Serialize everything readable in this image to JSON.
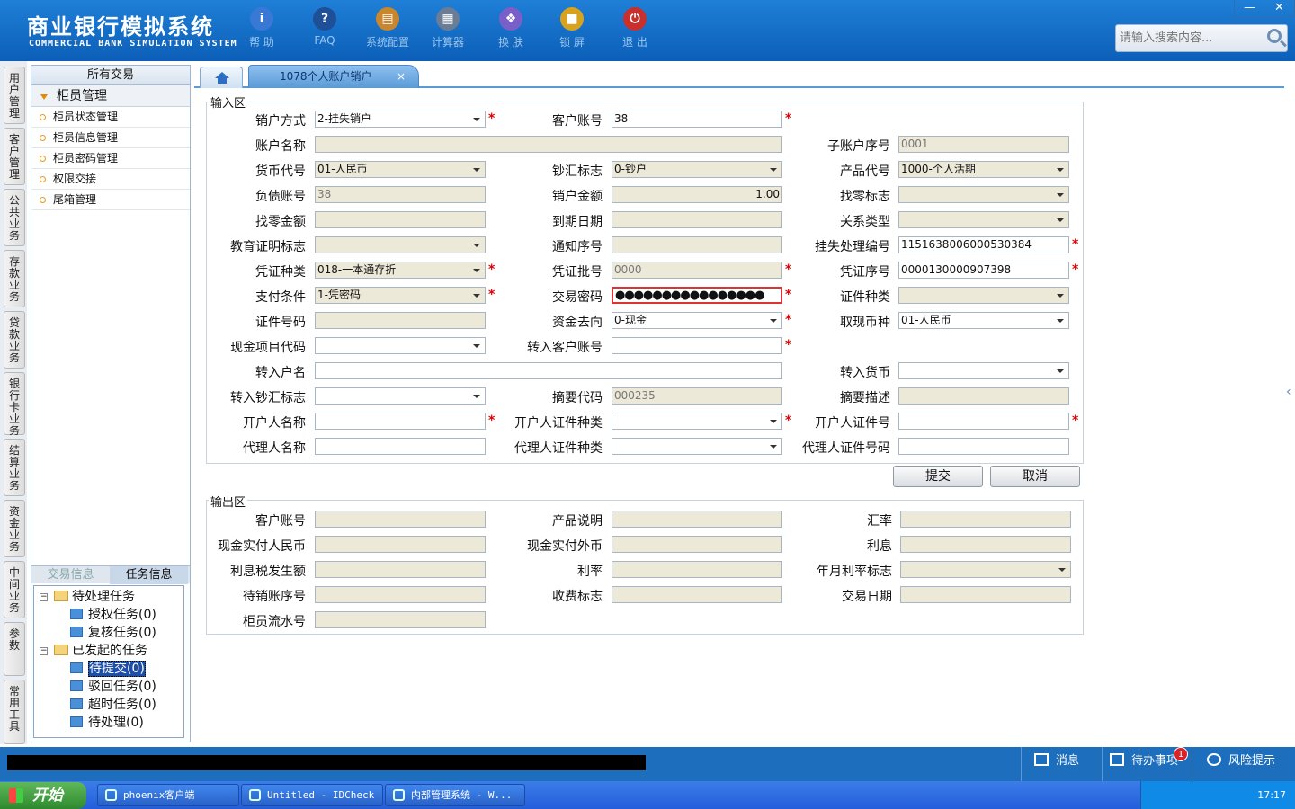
{
  "app": {
    "title_cn": "商业银行模拟系统",
    "title_en": "COMMERCIAL BANK SIMULATION SYSTEM"
  },
  "toolbar": [
    {
      "label": "帮 助",
      "icon": "info-icon",
      "glyph": "i",
      "color": "#3a78d6"
    },
    {
      "label": "FAQ",
      "icon": "faq-icon",
      "glyph": "?",
      "color": "#1f4f96"
    },
    {
      "label": "系统配置",
      "icon": "toolbox-icon",
      "glyph": "▤",
      "color": "#c9862c"
    },
    {
      "label": "计算器",
      "icon": "calculator-icon",
      "glyph": "▦",
      "color": "#6b7d94"
    },
    {
      "label": "换 肤",
      "icon": "shirt-icon",
      "glyph": "❖",
      "color": "#7a5fc9"
    },
    {
      "label": "锁 屏",
      "icon": "lock-icon",
      "glyph": "■",
      "color": "#d9a21e"
    },
    {
      "label": "退 出",
      "icon": "power-icon",
      "glyph": "⏻",
      "color": "#c9302c"
    }
  ],
  "window": {
    "minimize": "—",
    "close": "✕"
  },
  "search": {
    "placeholder": "请输入搜索内容..."
  },
  "left_tabs": [
    "用户管理",
    "客户管理",
    "公共业务",
    "存款业务",
    "贷款业务",
    "银行卡业务",
    "结算业务",
    "资金业务",
    "中间业务",
    "参数",
    "常用工具"
  ],
  "sidebar": {
    "title": "所有交易",
    "section": "柜员管理",
    "items": [
      "柜员状态管理",
      "柜员信息管理",
      "柜员密码管理",
      "权限交接",
      "尾箱管理"
    ]
  },
  "task_panel": {
    "tabs": [
      "交易信息",
      "任务信息"
    ],
    "tree": [
      {
        "label": "待处理任务",
        "type": "folder"
      },
      {
        "label": "授权任务(0)",
        "type": "leaf"
      },
      {
        "label": "复核任务(0)",
        "type": "leaf"
      },
      {
        "label": "已发起的任务",
        "type": "folder"
      },
      {
        "label": "待提交(0)",
        "type": "leaf",
        "selected": true
      },
      {
        "label": "驳回任务(0)",
        "type": "leaf"
      },
      {
        "label": "超时任务(0)",
        "type": "leaf"
      },
      {
        "label": "待处理(0)",
        "type": "leaf"
      }
    ]
  },
  "tabs": {
    "active": "1078个人账户销户",
    "close": "×"
  },
  "input_area": {
    "title": "输入区",
    "fields": [
      {
        "label": "销户方式",
        "value": "2-挂失销户",
        "dd": true,
        "req": true
      },
      {
        "label": "客户账号",
        "value": "38",
        "ro": false,
        "req": true
      },
      {
        "label": "账户名称",
        "value": "",
        "ro": true,
        "wide": true
      },
      {
        "label": "子账户序号",
        "value": "0001",
        "ro": true
      },
      {
        "label": "货币代号",
        "value": "01-人民币",
        "ro": true,
        "dd": true
      },
      {
        "label": "钞汇标志",
        "value": "0-钞户",
        "ro": true,
        "dd": true
      },
      {
        "label": "产品代号",
        "value": "1000-个人活期",
        "ro": true,
        "dd": true
      },
      {
        "label": "负债账号",
        "value": "38",
        "ro": true
      },
      {
        "label": "销户金额",
        "value": "1.00",
        "ro": true,
        "num": true
      },
      {
        "label": "找零标志",
        "value": "",
        "ro": true,
        "dd": true
      },
      {
        "label": "找零金额",
        "value": "",
        "ro": true
      },
      {
        "label": "到期日期",
        "value": "",
        "ro": true
      },
      {
        "label": "关系类型",
        "value": "",
        "ro": true,
        "dd": true
      },
      {
        "label": "教育证明标志",
        "value": "",
        "ro": true,
        "dd": true
      },
      {
        "label": "通知序号",
        "value": "",
        "ro": true
      },
      {
        "label": "挂失处理编号",
        "value": "1151638006000530384",
        "req": true
      },
      {
        "label": "凭证种类",
        "value": "018-一本通存折",
        "ro": true,
        "dd": true,
        "req": true
      },
      {
        "label": "凭证批号",
        "value": "0000",
        "ro": true,
        "req": true
      },
      {
        "label": "凭证序号",
        "value": "0000130000907398",
        "req": true
      },
      {
        "label": "支付条件",
        "value": "1-凭密码",
        "ro": true,
        "dd": true,
        "req": true
      },
      {
        "label": "交易密码",
        "value": "●●●●●●●●●●●●●●●●",
        "pwd": true,
        "req": true
      },
      {
        "label": "证件种类",
        "value": "",
        "ro": true,
        "dd": true
      },
      {
        "label": "证件号码",
        "value": "",
        "ro": true
      },
      {
        "label": "资金去向",
        "value": "0-现金",
        "dd": true,
        "req": true
      },
      {
        "label": "取现币种",
        "value": "01-人民币",
        "dd": true
      },
      {
        "label": "现金项目代码",
        "value": "",
        "dd": true
      },
      {
        "label": "转入客户账号",
        "value": "",
        "req": true
      },
      {
        "label": "转入户名",
        "value": "",
        "wide": true
      },
      {
        "label": "转入货币",
        "value": "",
        "dd": true
      },
      {
        "label": "转入钞汇标志",
        "value": "",
        "dd": true
      },
      {
        "label": "摘要代码",
        "value": "000235",
        "ro": true
      },
      {
        "label": "摘要描述",
        "value": "",
        "ro": true
      },
      {
        "label": "开户人名称",
        "value": "",
        "req": true
      },
      {
        "label": "开户人证件种类",
        "value": "",
        "dd": true,
        "req": true
      },
      {
        "label": "开户人证件号",
        "value": "",
        "req": true
      },
      {
        "label": "代理人名称",
        "value": ""
      },
      {
        "label": "代理人证件种类",
        "value": "",
        "dd": true
      },
      {
        "label": "代理人证件号码",
        "value": ""
      }
    ]
  },
  "buttons": {
    "submit": "提交",
    "cancel": "取消"
  },
  "output_area": {
    "title": "输出区",
    "fields": [
      "客户账号",
      "产品说明",
      "汇率",
      "现金实付人民币",
      "现金实付外币",
      "利息",
      "利息税发生额",
      "利率",
      "年月利率标志",
      "待销账序号",
      "收费标志",
      "交易日期",
      "柜员流水号"
    ]
  },
  "status": {
    "msg": "消息",
    "todo": "待办事项",
    "todo_count": "1",
    "risk": "风险提示"
  },
  "taskbar": {
    "start": "开始",
    "tasks": [
      "phoenix客户端",
      "Untitled - IDCheck",
      "内部管理系统 - W..."
    ],
    "time": "17:17"
  }
}
